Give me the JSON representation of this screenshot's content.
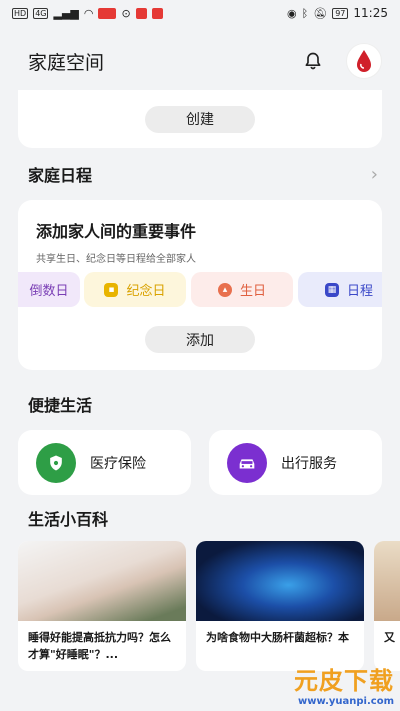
{
  "status_bar": {
    "left_chips": [
      "HD",
      "4G"
    ],
    "battery": "97",
    "time": "11:25"
  },
  "app_bar": {
    "title": "家庭空间",
    "icons": [
      "bell-icon",
      "avatar"
    ]
  },
  "top_card": {
    "create_label": "创建"
  },
  "family_schedule": {
    "title": "家庭日程",
    "card_title": "添加家人间的重要事件",
    "card_subtitle": "共享生日、纪念日等日程给全部家人",
    "chips": [
      {
        "label": "倒数日",
        "bg": "#f1e8fa",
        "color": "#7a3fb5",
        "icon": "countdown-icon"
      },
      {
        "label": "纪念日",
        "bg": "#fdf6dc",
        "color": "#d9a200",
        "icon": "anniversary-icon"
      },
      {
        "label": "生日",
        "bg": "#fdecea",
        "color": "#e06040",
        "icon": "birthday-cake-icon"
      },
      {
        "label": "日程",
        "bg": "#e9ebfb",
        "color": "#3a48c8",
        "icon": "calendar-icon"
      }
    ],
    "add_label": "添加"
  },
  "convenient_life": {
    "title": "便捷生活",
    "items": [
      {
        "label": "医疗保险",
        "icon": "shield-icon",
        "color": "#2e9e46"
      },
      {
        "label": "出行服务",
        "icon": "car-icon",
        "color": "#7b2fd0"
      }
    ]
  },
  "encyclopedia": {
    "title": "生活小百科",
    "articles": [
      {
        "text": "睡得好能提高抵抗力吗？怎么才算\"好睡眠\"？..."
      },
      {
        "text": "为啥食物中大肠杆菌超标？本"
      },
      {
        "text": "又"
      }
    ]
  },
  "watermark": {
    "main": "元皮下载",
    "url": "www.yuanpi.com"
  }
}
